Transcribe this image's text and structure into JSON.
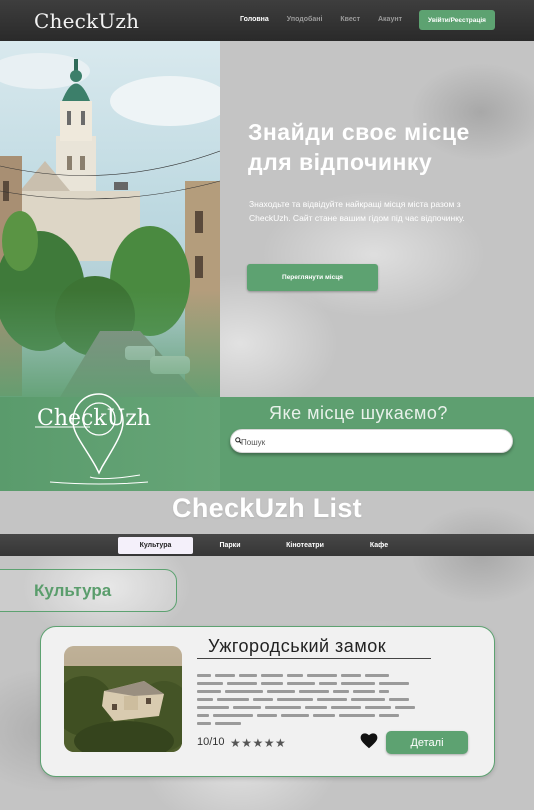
{
  "header": {
    "logo": "CheckUzh",
    "nav": [
      {
        "label": "Головна",
        "active": true
      },
      {
        "label": "Уподобані",
        "active": false
      },
      {
        "label": "Квест",
        "active": false
      },
      {
        "label": "Акаунт",
        "active": false
      }
    ],
    "login_label": "Увійти/Реєстрація"
  },
  "hero": {
    "title_line1": "Знайди своє місце",
    "title_line2": "для відпочинку",
    "description": "Знаходьте та відвідуйте найкращі місця міста разом з CheckUzh. Сайт стане вашим гідом під час відпочинку.",
    "button_label": "Переглянути місця"
  },
  "search": {
    "logo_text": "CheckUzh",
    "title": "Яке місце шукаємо?",
    "placeholder": "Пошук"
  },
  "list": {
    "title": "CheckUzh List",
    "tabs": [
      {
        "label": "Культура",
        "active": true
      },
      {
        "label": "Парки",
        "active": false
      },
      {
        "label": "Кінотеатри",
        "active": false
      },
      {
        "label": "Кафе",
        "active": false
      }
    ],
    "category": "Культура",
    "card": {
      "title": "Ужгородський замок",
      "rating": "10/10",
      "stars": "★★★★★",
      "details_label": "Деталі"
    }
  },
  "colors": {
    "accent": "#5da271",
    "header_bg": "#333333",
    "band_bg": "#5e9f70"
  }
}
